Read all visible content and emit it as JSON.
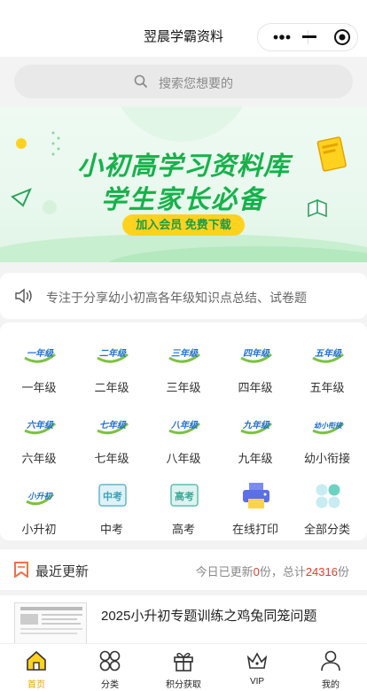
{
  "app": {
    "title": "翌晨学霸资料"
  },
  "search": {
    "placeholder": "搜索您想要的"
  },
  "banner": {
    "line1": "小初高学习资料库",
    "line2": "学生家长必备",
    "cta": "加入会员  免费下载"
  },
  "notice": {
    "text": "专注于分享幼小初高各年级知识点总结、试卷题"
  },
  "categories": [
    {
      "label": "一年级",
      "icon": "grade-1-icon"
    },
    {
      "label": "二年级",
      "icon": "grade-2-icon"
    },
    {
      "label": "三年级",
      "icon": "grade-3-icon"
    },
    {
      "label": "四年级",
      "icon": "grade-4-icon"
    },
    {
      "label": "五年级",
      "icon": "grade-5-icon"
    },
    {
      "label": "六年级",
      "icon": "grade-6-icon"
    },
    {
      "label": "七年级",
      "icon": "grade-7-icon"
    },
    {
      "label": "八年级",
      "icon": "grade-8-icon"
    },
    {
      "label": "九年级",
      "icon": "grade-9-icon"
    },
    {
      "label": "幼小衔接",
      "icon": "preschool-icon"
    },
    {
      "label": "小升初",
      "icon": "primary-to-middle-icon"
    },
    {
      "label": "中考",
      "icon": "zhongkao-icon"
    },
    {
      "label": "高考",
      "icon": "gaokao-icon"
    },
    {
      "label": "在线打印",
      "icon": "printer-icon"
    },
    {
      "label": "全部分类",
      "icon": "all-categories-icon"
    }
  ],
  "icon_texts": {
    "g1": "一年级",
    "g2": "二年级",
    "g3": "三年级",
    "g4": "四年级",
    "g5": "五年级",
    "g6": "六年级",
    "g7": "七年级",
    "g8": "八年级",
    "g9": "九年级",
    "g10": "幼小衔接",
    "g11": "小升初",
    "g12": "中考",
    "g13": "高考"
  },
  "recent": {
    "title": "最近更新",
    "prefix": "今日已更新",
    "today_count": "0",
    "mid": "份，总计",
    "total_count": "24316",
    "suffix": "份"
  },
  "article": {
    "title": "2025小升初专题训练之鸡兔同笼问题"
  },
  "tabs": [
    {
      "label": "首页",
      "icon": "home-icon",
      "active": true
    },
    {
      "label": "分类",
      "icon": "category-icon",
      "active": false
    },
    {
      "label": "积分获取",
      "icon": "gift-icon",
      "active": false
    },
    {
      "label": "VIP",
      "icon": "crown-icon",
      "active": false
    },
    {
      "label": "我的",
      "icon": "user-icon",
      "active": false
    }
  ],
  "colors": {
    "brand_green": "#15b24a",
    "accent_yellow": "#ffd21f",
    "highlight_red": "#e63b2e",
    "active_tab": "#e8a000"
  }
}
